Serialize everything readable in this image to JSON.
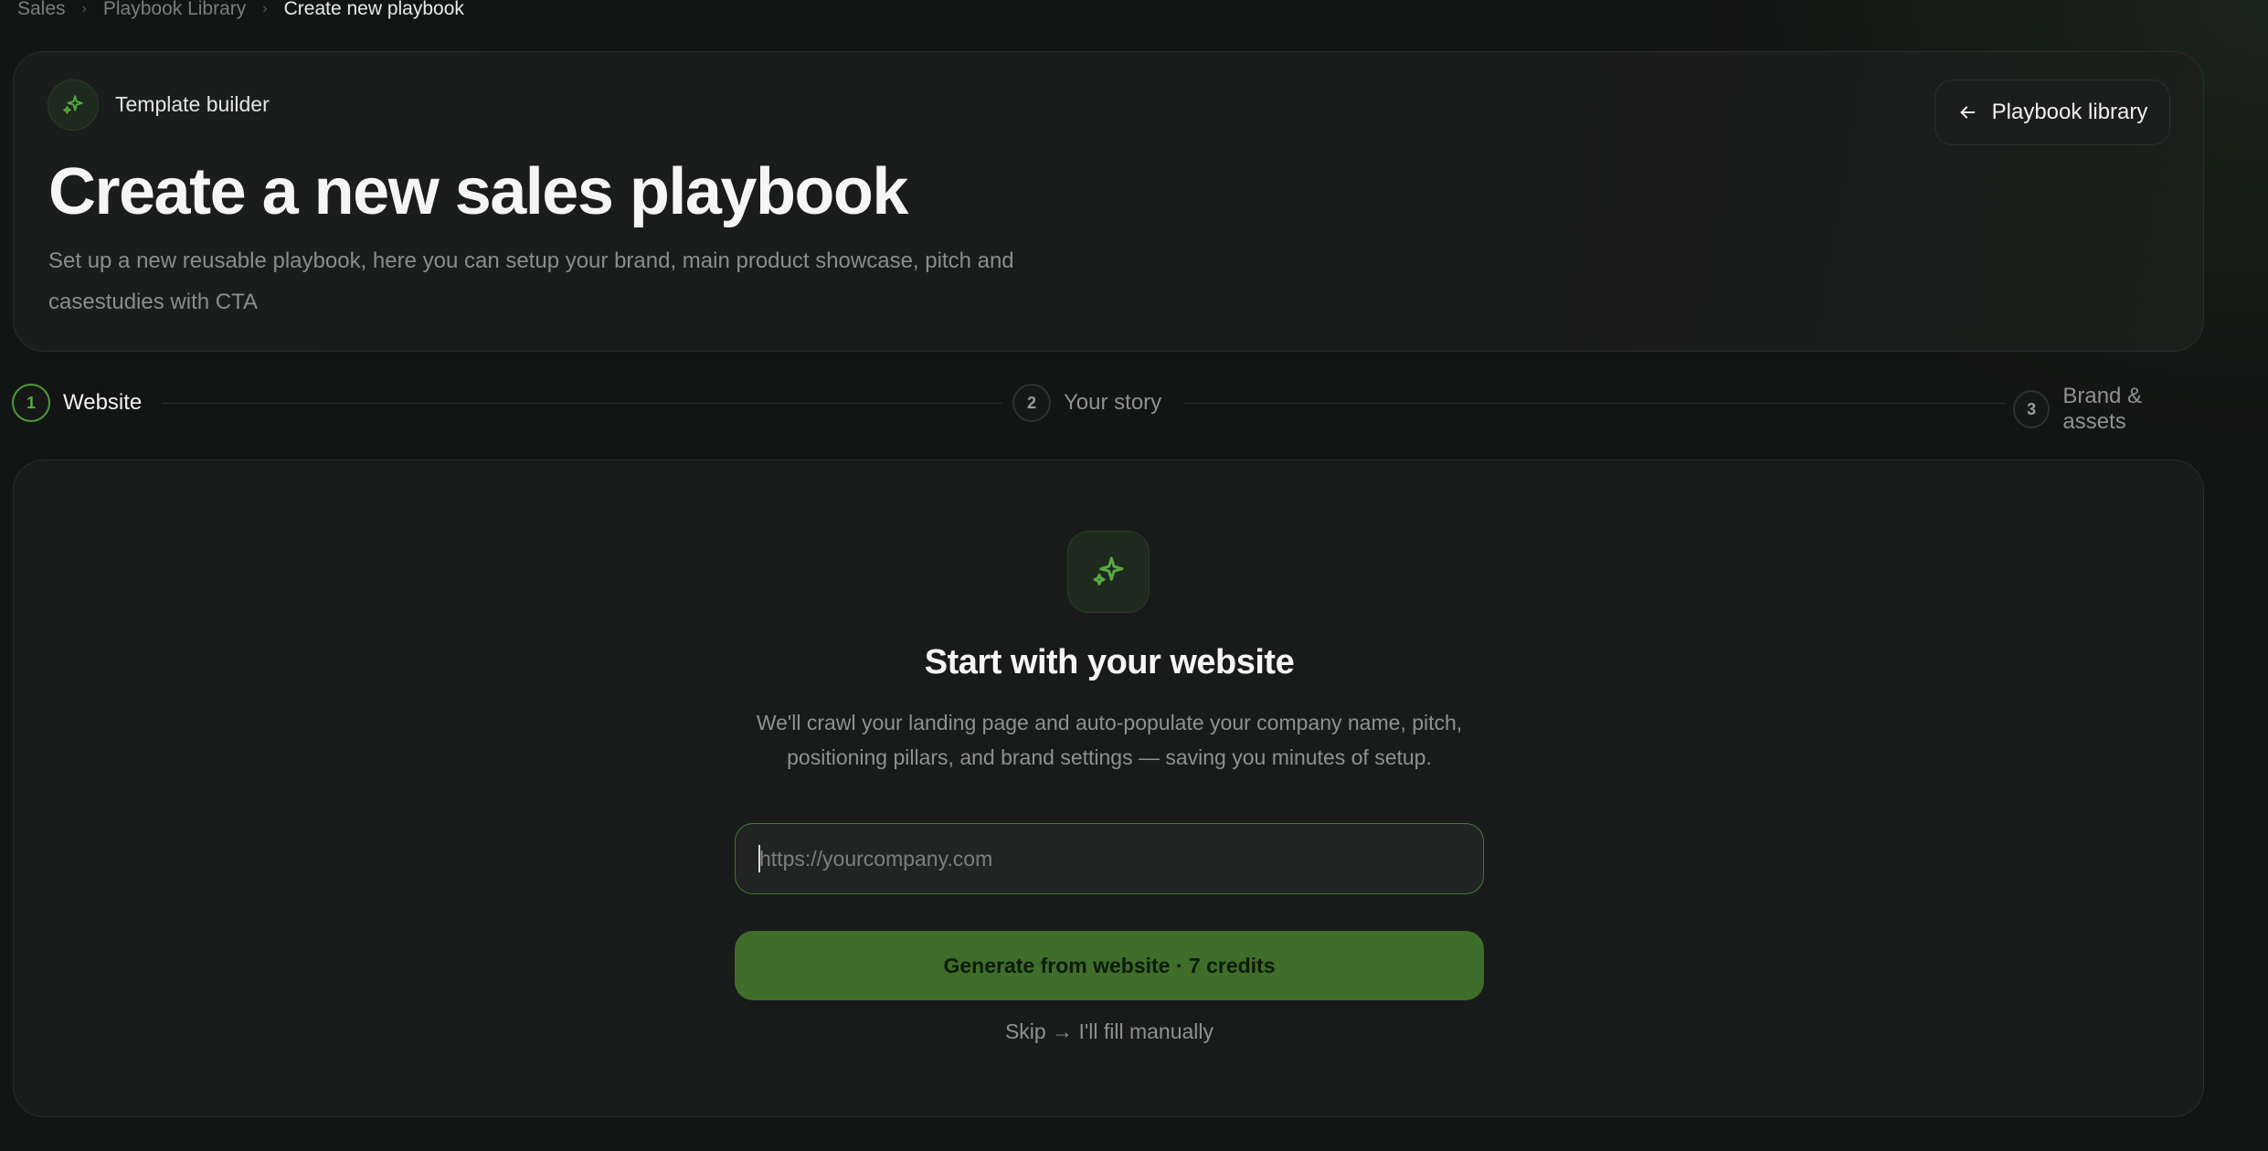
{
  "breadcrumb": {
    "items": [
      "Sales",
      "Playbook Library"
    ],
    "current": "Create new playbook"
  },
  "hero": {
    "badge_label": "Template builder",
    "title": "Create a new sales playbook",
    "subtitle": "Set up a new reusable playbook, here you can setup your brand, main product showcase, pitch and casestudies with CTA",
    "library_button": "Playbook library"
  },
  "steps": [
    {
      "number": "1",
      "label": "Website",
      "active": true
    },
    {
      "number": "2",
      "label": "Your story",
      "active": false
    },
    {
      "number": "3",
      "label": "Brand & assets",
      "active": false
    }
  ],
  "main": {
    "title": "Start with your website",
    "description": "We'll crawl your landing page and auto-populate your company name, pitch, positioning pillars, and brand settings — saving you minutes of setup.",
    "url_input": {
      "value": "",
      "placeholder": "https://yourcompany.com"
    },
    "generate_button": "Generate from website · 7 credits",
    "skip_link": "Skip → I'll fill manually"
  },
  "icons": {
    "badge": "sparkles-icon",
    "main": "sparkles-icon",
    "back": "arrow-left-icon"
  },
  "colors": {
    "accent": "#56a942",
    "button_bg": "#3e6e2a",
    "background": "#131414",
    "card": "#191a1a"
  }
}
